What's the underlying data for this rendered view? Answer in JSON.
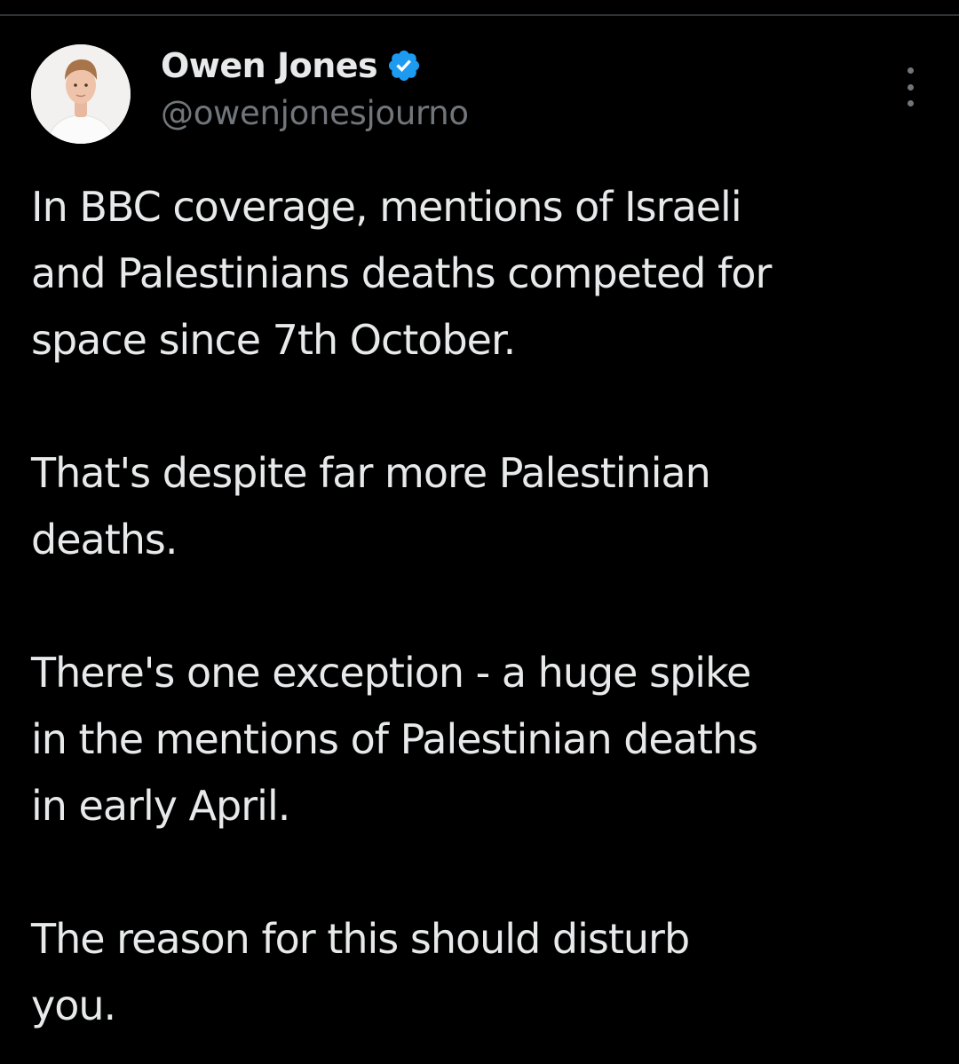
{
  "author": {
    "display_name": "Owen Jones",
    "handle": "@owenjonesjourno",
    "verified_color": "#1d9bf0"
  },
  "icons": {
    "verified": "verified-badge-icon",
    "more": "more-vertical-icon",
    "avatar": "avatar-photo"
  },
  "tweet": {
    "paragraphs": [
      [
        "In BBC coverage, mentions of Israeli",
        "and Palestinians deaths competed for",
        "space since 7th October."
      ],
      [
        "That's despite far more Palestinian",
        "deaths."
      ],
      [
        "There's one exception - a huge spike",
        "in the mentions of Palestinian deaths",
        "in early April."
      ],
      [
        "The reason for this should disturb",
        "you."
      ]
    ]
  }
}
